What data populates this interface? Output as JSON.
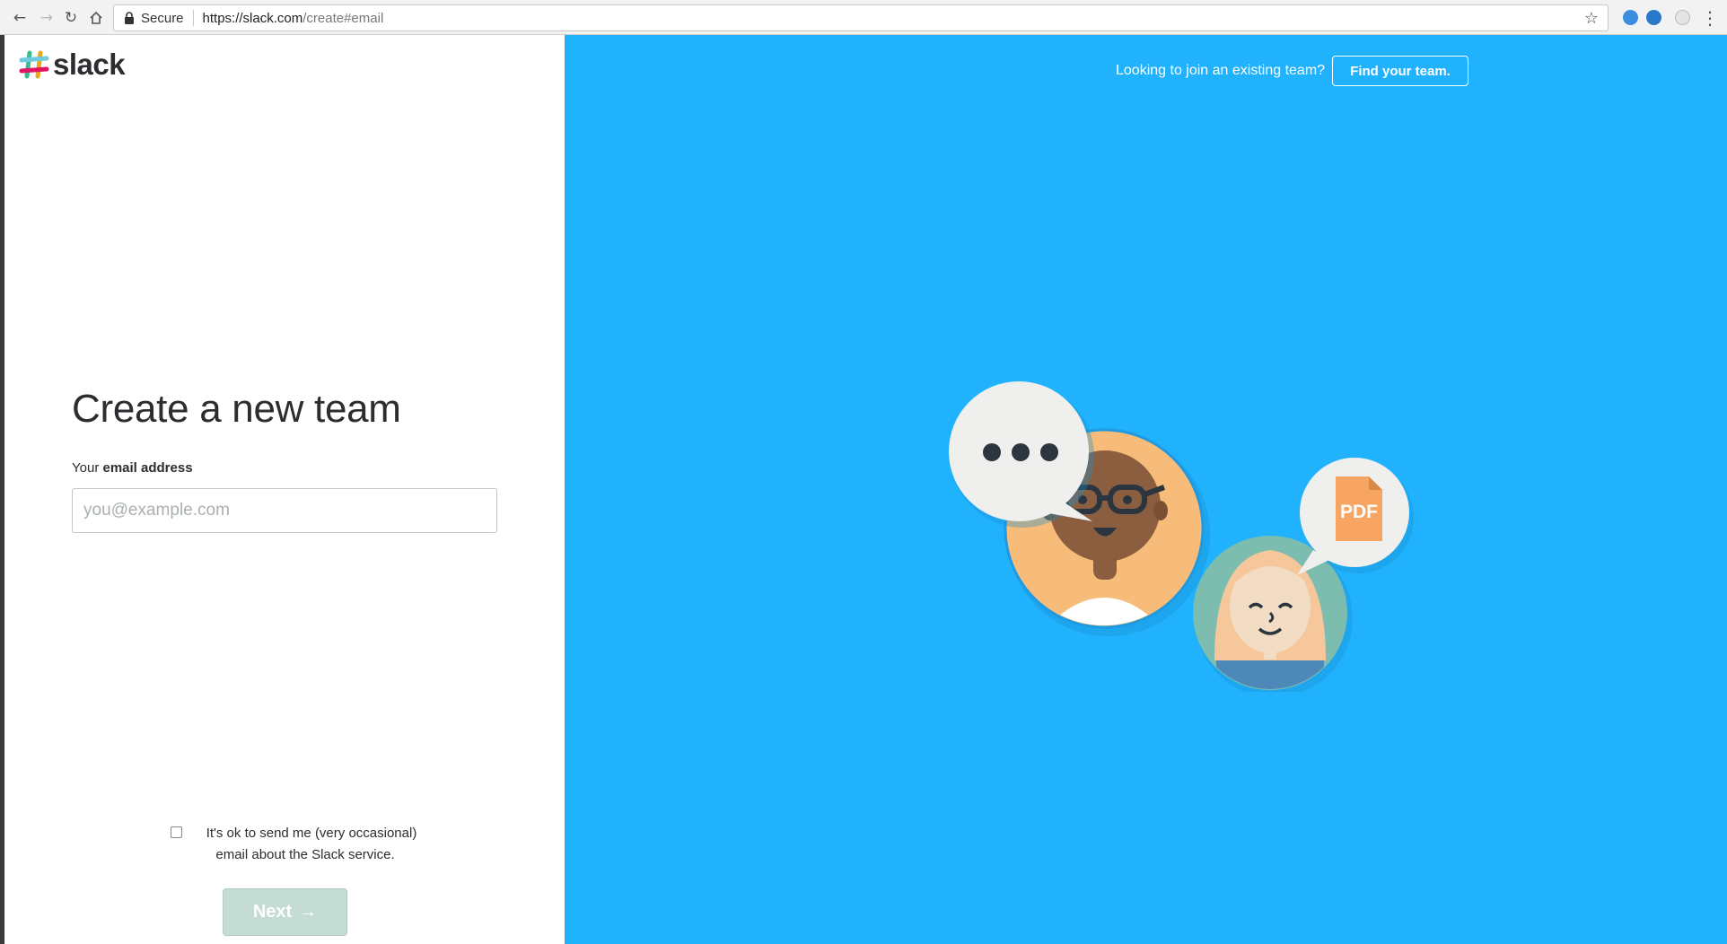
{
  "browser": {
    "secure_label": "Secure",
    "url_host": "https://slack.com",
    "url_path": "/create#email"
  },
  "logo": {
    "text": "slack"
  },
  "form": {
    "title": "Create a new team",
    "email_label_prefix": "Your ",
    "email_label_bold": "email address",
    "email_placeholder": "you@example.com",
    "email_value": "",
    "consent_line1": "It's ok to send me (very occasional)",
    "consent_line2": "email about the Slack service.",
    "consent_checked": false,
    "next_label": "Next",
    "next_arrow": "→"
  },
  "header": {
    "join_text": "Looking to join an existing team?",
    "find_team_label": "Find your team."
  },
  "illustration": {
    "pdf_label": "PDF"
  },
  "colors": {
    "brand_blue": "#20b2fc",
    "disabled_button": "#c5dcd4",
    "text_dark": "#2c2d30"
  }
}
